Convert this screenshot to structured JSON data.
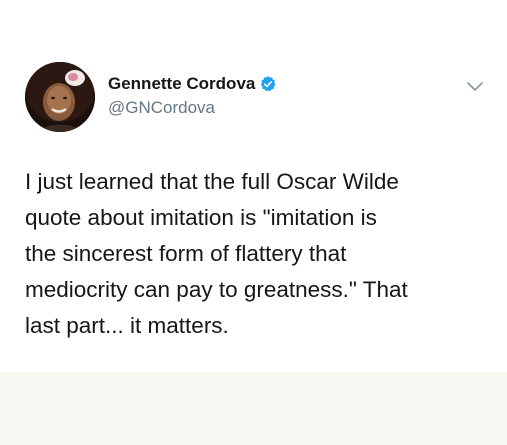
{
  "author": {
    "display_name": "Gennette Cordova",
    "handle": "@GNCordova",
    "verified": true
  },
  "tweet": {
    "lines": [
      "I just learned that the full Oscar Wilde",
      "quote about imitation is \"imitation is",
      "the sincerest form of flattery that",
      "mediocrity can pay to greatness.\" That",
      "last part... it matters."
    ]
  },
  "icons": {
    "verified": "verified-badge-icon",
    "menu": "chevron-down-icon"
  },
  "colors": {
    "verified_blue": "#1da1f2",
    "text": "#14171a",
    "secondary_text": "#657786",
    "footer_band": "#f7f7f2"
  }
}
